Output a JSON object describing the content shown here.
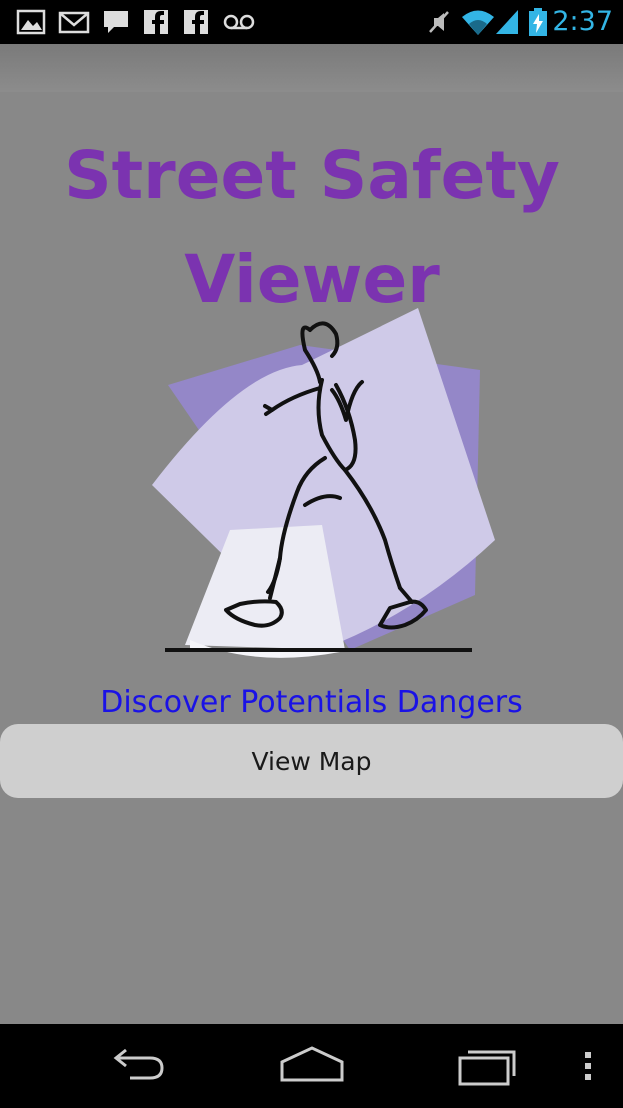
{
  "status_bar": {
    "time": "2:37",
    "notification_icons": [
      "gallery-icon",
      "gmail-icon",
      "chat-icon",
      "facebook-icon",
      "facebook-icon",
      "voicemail-icon"
    ],
    "system_icons": [
      "mute-icon",
      "wifi-icon",
      "signal-icon",
      "battery-charging-icon"
    ],
    "accent_color": "#33b5e5"
  },
  "app": {
    "logo_title_line1": "Street Safety",
    "logo_title_line2": "Viewer",
    "logo_color": "#7b33b0",
    "tagline": "Discover Potentials Dangers",
    "tagline_color": "#1a12e6",
    "view_map_label": "View Map"
  },
  "nav_bar": {
    "buttons": [
      "back-icon",
      "home-icon",
      "recent-apps-icon",
      "overflow-menu-icon"
    ]
  }
}
